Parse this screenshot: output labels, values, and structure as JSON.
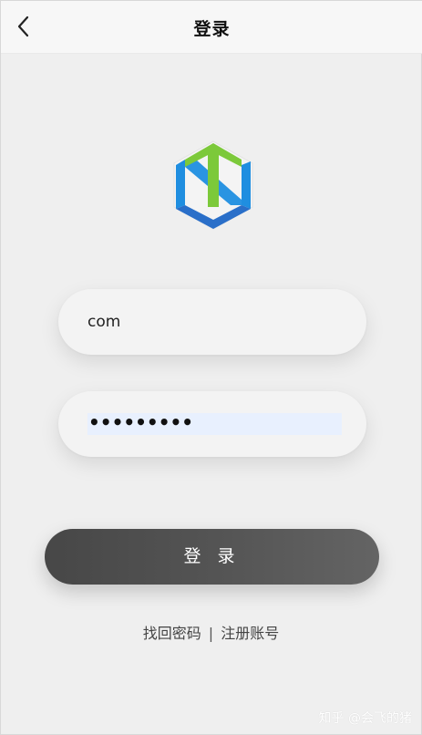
{
  "nav": {
    "title": "登录",
    "back_icon": "chevron-left-icon"
  },
  "logo": {
    "icon": "app-logo-icon",
    "colors": {
      "green": "#7cc93a",
      "blue": "#1f8ee0",
      "dark_blue": "#2a6fc9"
    }
  },
  "form": {
    "username_value": "com",
    "password_value": "•••••••••",
    "password_autofill_bg": "#e8f0fe"
  },
  "login_button": {
    "label": "登 录"
  },
  "links": {
    "forgot_password": "找回密码",
    "separator": "|",
    "register": "注册账号"
  },
  "watermark": {
    "text": "知乎 @会飞的猪"
  }
}
